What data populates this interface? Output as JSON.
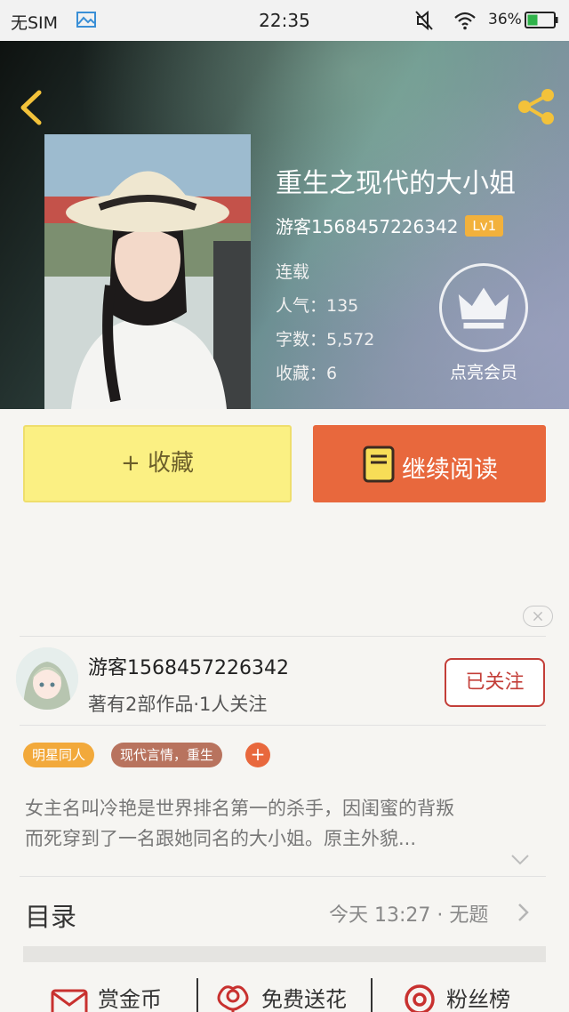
{
  "status_bar": {
    "carrier": "无SIM",
    "time": "22:35",
    "battery_percent": "36%"
  },
  "book": {
    "title": "重生之现代的大小姐",
    "author": "游客1568457226342",
    "level": "Lv1",
    "status": "连载",
    "popularity": "人气：135",
    "word_count": "字数：5,572",
    "favorites": "收藏：6"
  },
  "vip": {
    "label": "点亮会员"
  },
  "actions": {
    "favorite_label": "+ 收藏",
    "read_label": "继续阅读"
  },
  "author_card": {
    "name": "游客1568457226342",
    "meta": "著有2部作品·1人关注",
    "follow_label": "已关注"
  },
  "tags": {
    "tag1": "明星同人",
    "tag2": "现代言情，重生",
    "add": "+"
  },
  "synopsis": {
    "line1": "女主名叫冷艳是世界排名第一的杀手，因闺蜜的背叛",
    "line2": "而死穿到了一名跟她同名的大小姐。原主外貌..."
  },
  "toc": {
    "label": "目录",
    "latest": "今天 13:27 · 无题"
  },
  "bottom": {
    "coins": "赏金币",
    "flowers": "免费送花",
    "fans": "粉丝榜"
  },
  "colors": {
    "accent_orange": "#e8683d",
    "favorite_yellow": "#fbf083",
    "follow_red": "#c33e38",
    "level_badge": "#f2b13c"
  }
}
